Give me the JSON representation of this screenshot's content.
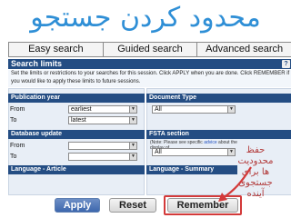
{
  "title": "محدود کردن جستجو",
  "tabs": [
    "Easy search",
    "Guided search",
    "Advanced search"
  ],
  "search_limits": {
    "heading": "Search limits",
    "intro": "Set the limits or restrictions to your searches for this session. Click APPLY when you are done. Click REMEMBER if you would like to apply these limits to future sessions."
  },
  "publication_year": {
    "label": "Publication year",
    "from_label": "From",
    "from_value": "earliest",
    "to_label": "To",
    "to_value": "latest"
  },
  "document_type": {
    "label": "Document Type",
    "value": "All"
  },
  "database_update": {
    "label": "Database update",
    "from_label": "From",
    "to_label": "To"
  },
  "fsta_section": {
    "label": "FSTA section",
    "hint_prefix": "(Note: Please see specific",
    "hint_link": "advice",
    "hint_suffix": "about the display of",
    "value": "All"
  },
  "language_article": {
    "label": "Language - Article"
  },
  "language_summary": {
    "label": "Language - Summary"
  },
  "buttons": {
    "apply": "Apply",
    "reset": "Reset",
    "remember": "Remember"
  },
  "note": "حفظ محدودیت ها برای جستجوی آینده",
  "colors": {
    "title": "#2f8fd6",
    "section_header": "#244d83",
    "panel_bg": "#e8eef6",
    "annotation": "#d33a3a"
  },
  "icons": {
    "help": "help-icon",
    "select_arrow": "chevron-down-icon",
    "pointer": "arrow-icon"
  }
}
